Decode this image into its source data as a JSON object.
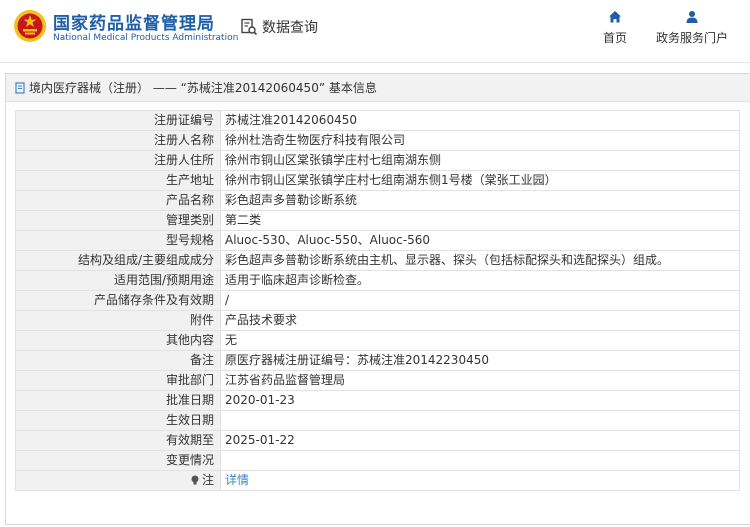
{
  "header": {
    "brand_cn": "国家药品监督管理局",
    "brand_en": "National Medical Products Administration",
    "data_query": "数据查询",
    "nav": [
      {
        "label": "首页",
        "icon": "home-icon"
      },
      {
        "label": "政务服务门户",
        "icon": "user-icon"
      }
    ]
  },
  "panel": {
    "title": "境内医疗器械（注册） —— “苏械注准20142060450” 基本信息"
  },
  "rows": [
    {
      "label": "注册证编号",
      "value": "苏械注准20142060450"
    },
    {
      "label": "注册人名称",
      "value": "徐州杜浩奇生物医疗科技有限公司"
    },
    {
      "label": "注册人住所",
      "value": "徐州市铜山区棠张镇学庄村七组南湖东侧"
    },
    {
      "label": "生产地址",
      "value": "徐州市铜山区棠张镇学庄村七组南湖东侧1号楼（棠张工业园）"
    },
    {
      "label": "产品名称",
      "value": "彩色超声多普勒诊断系统"
    },
    {
      "label": "管理类别",
      "value": "第二类"
    },
    {
      "label": "型号规格",
      "value": "Aluoc-530、Aluoc-550、Aluoc-560"
    },
    {
      "label": "结构及组成/主要组成成分",
      "value": "彩色超声多普勒诊断系统由主机、显示器、探头（包括标配探头和选配探头）组成。"
    },
    {
      "label": "适用范围/预期用途",
      "value": "适用于临床超声诊断检查。"
    },
    {
      "label": "产品储存条件及有效期",
      "value": "/"
    },
    {
      "label": "附件",
      "value": "产品技术要求"
    },
    {
      "label": "其他内容",
      "value": "无"
    },
    {
      "label": "备注",
      "value": "原医疗器械注册证编号：苏械注准20142230450"
    },
    {
      "label": "审批部门",
      "value": "江苏省药品监督管理局"
    },
    {
      "label": "批准日期",
      "value": "2020-01-23"
    },
    {
      "label": "生效日期",
      "value": ""
    },
    {
      "label": "有效期至",
      "value": "2025-01-22"
    },
    {
      "label": "变更情况",
      "value": ""
    }
  ],
  "note_row": {
    "label": "注",
    "link": "详情"
  },
  "colors": {
    "brand": "#1f5fa8",
    "link": "#3a86c8",
    "label_bg": "#f1f1f1",
    "emblem_red": "#c8161d",
    "emblem_gold": "#f2c21a"
  }
}
